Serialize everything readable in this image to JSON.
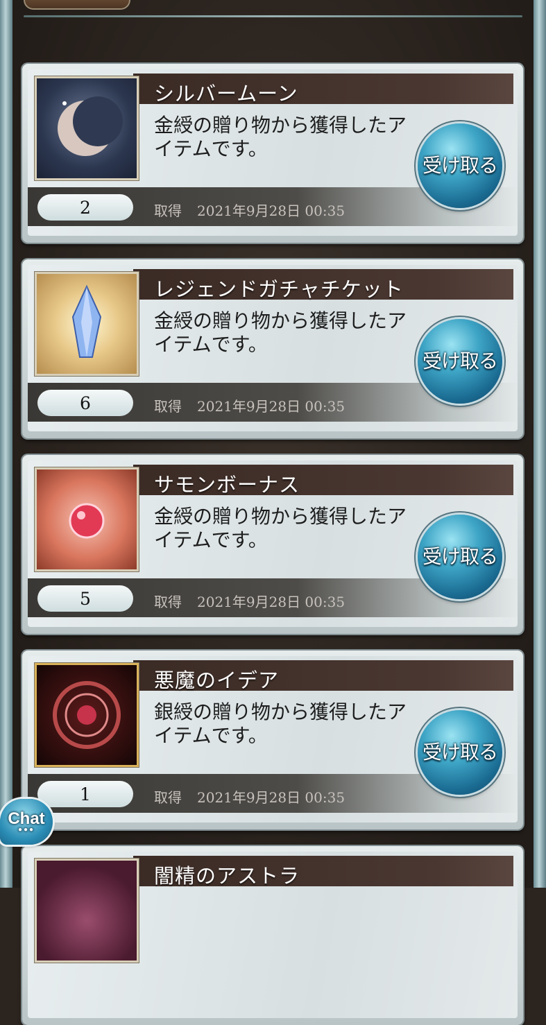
{
  "items": [
    {
      "name": "シルバームーン",
      "description": "金綬の贈り物から獲得したアイテムです。",
      "quantity": "2",
      "acquired_label": "取得",
      "acquired_date": "2021年9月28日 00:35",
      "receive_label": "受け取る",
      "icon": "silver-moon-icon"
    },
    {
      "name": "レジェンドガチャチケット",
      "description": "金綬の贈り物から獲得したアイテムです。",
      "quantity": "6",
      "acquired_label": "取得",
      "acquired_date": "2021年9月28日 00:35",
      "receive_label": "受け取る",
      "icon": "crystal-ticket-icon"
    },
    {
      "name": "サモンボーナス",
      "description": "金綬の贈り物から獲得したアイテムです。",
      "quantity": "5",
      "acquired_label": "取得",
      "acquired_date": "2021年9月28日 00:35",
      "receive_label": "受け取る",
      "icon": "red-orb-icon"
    },
    {
      "name": "悪魔のイデア",
      "description": "銀綬の贈り物から獲得したアイテムです。",
      "quantity": "1",
      "acquired_label": "取得",
      "acquired_date": "2021年9月28日 00:35",
      "receive_label": "受け取る",
      "icon": "demon-idea-icon"
    },
    {
      "name": "闇精のアストラ",
      "icon": "dark-astra-icon"
    }
  ],
  "chat_button": {
    "label": "Chat"
  }
}
